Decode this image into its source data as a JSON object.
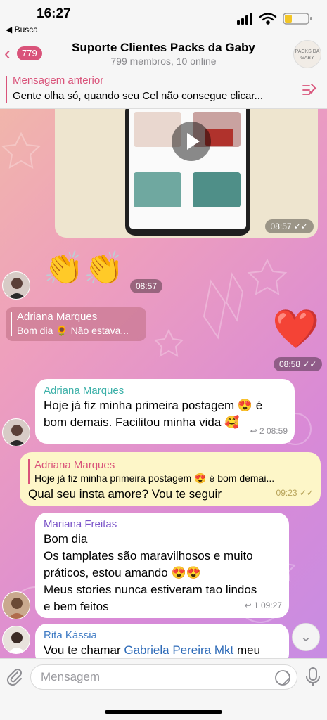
{
  "status_bar": {
    "time": "16:27",
    "back_app": "◀ Busca",
    "icons": [
      "signal-icon",
      "wifi-icon",
      "battery-icon"
    ]
  },
  "header": {
    "back_count": "779",
    "title": "Suporte Clientes Packs da Gaby",
    "subtitle": "799 membros, 10 online",
    "avatar_text": "PACKS DA GABY"
  },
  "pinned": {
    "title": "Mensagem anterior",
    "text": "Gente olha só, quando seu Cel não consegue clicar..."
  },
  "media_message": {
    "time": "08:57"
  },
  "emoji_message": {
    "emoji": "👏👏",
    "time": "08:57"
  },
  "quote_snippet": {
    "author": "Adriana Marques",
    "text": "Bom dia 🌻 Não estava..."
  },
  "heart_message": {
    "emoji": "❤️",
    "time": "08:58"
  },
  "messages": [
    {
      "sender": "Adriana Marques",
      "text1": "Hoje já fiz minha primeira postagem 😍 é",
      "text2": "bom demais. Facilitou minha vida 🥰",
      "meta": "↩ 2  08:59"
    },
    {
      "reply_author": "Adriana Marques",
      "reply_text": "Hoje já fiz minha primeira postagem 😍 é bom demai...",
      "text": "Qual seu insta amore? Vou te seguir",
      "meta": "09:23"
    },
    {
      "sender": "Mariana Freitas",
      "line1": "Bom dia",
      "line2": "Os tamplates são maravilhosos e muito",
      "line3": "práticos, estou amando 😍😍",
      "line4": "Meus stories nunca estiveram tao lindos",
      "line5": "e bem feitos",
      "meta": "↩ 1  09:27"
    },
    {
      "sender": "Rita Kássia",
      "text_before": "Vou te chamar ",
      "mention": "Gabriela Pereira Mkt",
      "text_after": " meu"
    }
  ],
  "composer": {
    "placeholder": "Mensagem"
  },
  "colors": {
    "accent": "#d9537a",
    "sender_adriana": "#3bb0a8",
    "sender_mariana": "#7b55c9",
    "sender_rita": "#3f7bc4",
    "own_bubble": "#fdf6c8"
  }
}
